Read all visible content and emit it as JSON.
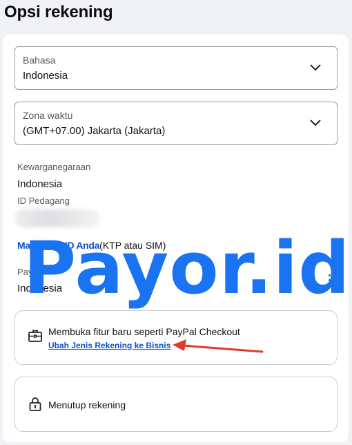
{
  "page": {
    "title": "Opsi rekening"
  },
  "language": {
    "label": "Bahasa",
    "value": "Indonesia"
  },
  "timezone": {
    "label": "Zona waktu",
    "value": "(GMT+07.00) Jakarta (Jakarta)"
  },
  "citizenship": {
    "label": "Kewarganegaraan",
    "value": "Indonesia"
  },
  "merchant_id": {
    "label": "ID Pedagang",
    "link_text": "Masukkan ID Anda",
    "hint": "(KTP atau SIM)"
  },
  "payor": {
    "label": "Payor",
    "value": "Indonesia"
  },
  "business_option": {
    "title": "Membuka fitur baru seperti PayPal Checkout",
    "link": "Ubah Jenis Rekening ke Bisnis"
  },
  "close_account": {
    "title": "Menutup rekening"
  },
  "watermark": {
    "text": "Payor.id"
  },
  "colors": {
    "link": "#0b4fd0",
    "watermark": "#1a73f0",
    "arrow": "#e03a30"
  }
}
